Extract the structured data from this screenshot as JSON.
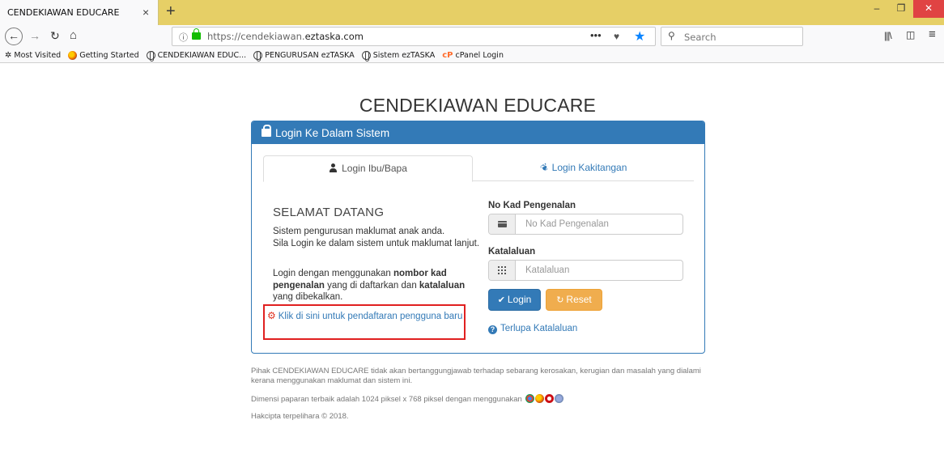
{
  "browser": {
    "tab_title": "CENDEKIAWAN EDUCARE",
    "tab_close": "×",
    "new_tab": "+",
    "url_prefix": "https://cendekiawan.",
    "url_domain": "eztaska.com",
    "search_placeholder": "Search",
    "bookmarks": [
      {
        "label": "Most Visited",
        "icon": "gear-icon"
      },
      {
        "label": "Getting Started",
        "icon": "firefox-icon"
      },
      {
        "label": "CENDEKIAWAN EDUC...",
        "icon": "globe-icon"
      },
      {
        "label": "PENGURUSAN ezTASKA",
        "icon": "globe-icon"
      },
      {
        "label": "Sistem ezTASKA",
        "icon": "globe-icon"
      },
      {
        "label": "cPanel Login",
        "icon": "cpanel-icon"
      }
    ]
  },
  "page": {
    "title": "CENDEKIAWAN EDUCARE",
    "panel_title": "Login Ke Dalam Sistem",
    "tabs": [
      {
        "label": "Login Ibu/Bapa",
        "active": true
      },
      {
        "label": "Login Kakitangan",
        "active": false
      }
    ],
    "welcome_heading": "SELAMAT DATANG",
    "desc_line1": "Sistem pengurusan maklumat anak anda.",
    "desc_line2": "Sila Login ke dalam sistem untuk maklumat lanjut.",
    "desc2_a": "Login dengan menggunakan ",
    "desc2_b": "nombor kad pengenalan",
    "desc2_c": " yang di daftarkan dan ",
    "desc2_d": "katalaluan",
    "desc2_e": " yang dibekalkan.",
    "register_link": "Klik di sini untuk pendaftaran pengguna baru",
    "ic_label": "No Kad Pengenalan",
    "ic_placeholder": "No Kad Pengenalan",
    "password_label": "Katalaluan",
    "password_placeholder": "Katalaluan",
    "login_button": "Login",
    "reset_button": "Reset",
    "forgot_link": "Terlupa Katalaluan"
  },
  "footer": {
    "disclaimer": "Pihak CENDEKIAWAN EDUCARE tidak akan bertanggungjawab terhadap sebarang kerosakan, kerugian dan masalah yang dialami kerana menggunakan maklumat dan sistem ini.",
    "resolution_note": "Dimensi paparan terbaik adalah 1024 piksel x 768 piksel dengan menggunakan",
    "copyright": "Hakcipta terpelihara © 2018."
  },
  "colors": {
    "primary": "#337ab7",
    "warning": "#f0ad4e",
    "highlight_border": "#e02020",
    "tabbar": "#e6cf66"
  }
}
